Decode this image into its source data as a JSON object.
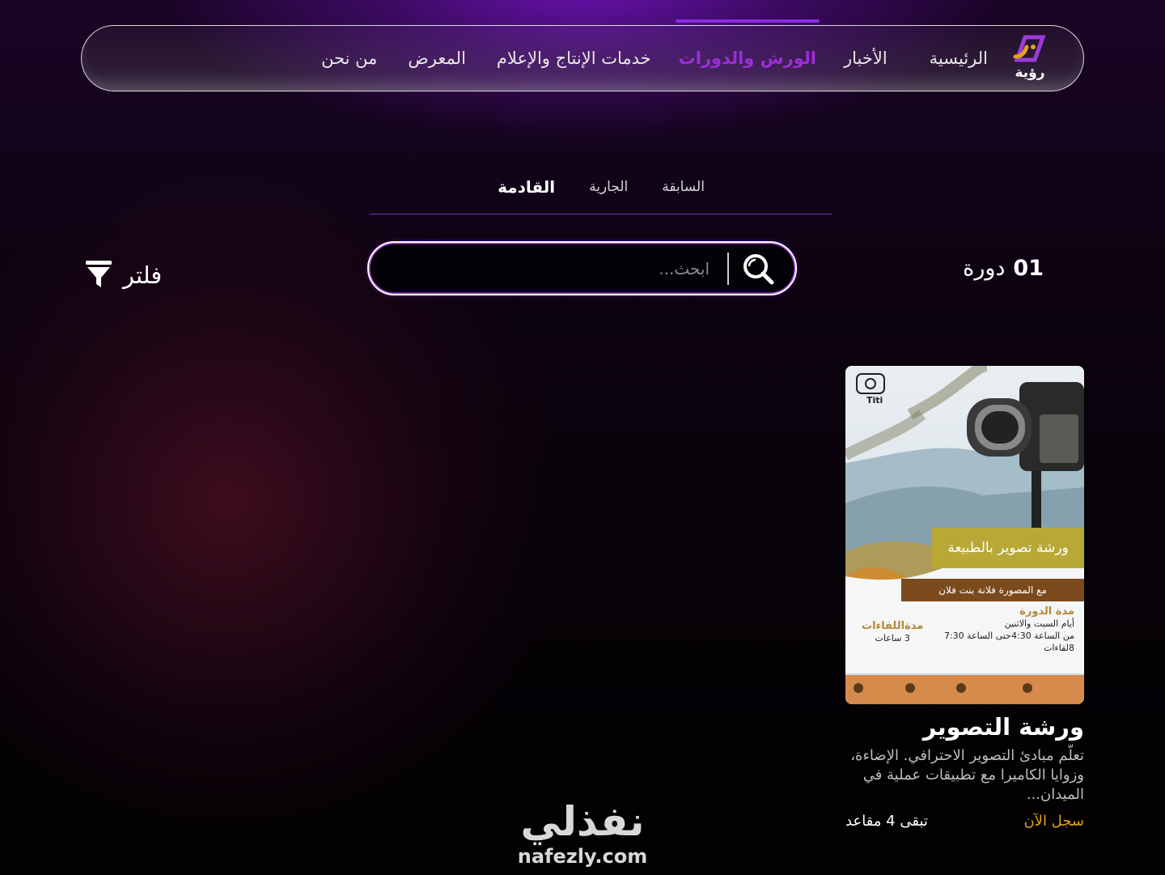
{
  "nav": {
    "logo_text": "رؤية",
    "items": [
      {
        "label": "الرئيسية",
        "active": false
      },
      {
        "label": "الأخبار",
        "active": false
      },
      {
        "label": "الورش والدورات",
        "active": true
      },
      {
        "label": "خدمات الإنتاج والإعلام",
        "active": false
      },
      {
        "label": "المعرض",
        "active": false
      },
      {
        "label": "من نحن",
        "active": false
      }
    ]
  },
  "tabs": [
    {
      "label": "السابقة"
    },
    {
      "label": "الجارية"
    },
    {
      "label": "القادمة"
    }
  ],
  "results": {
    "count": "01",
    "unit": "دورة"
  },
  "search": {
    "placeholder": "ابحث..."
  },
  "filter": {
    "label": "فلتر"
  },
  "card": {
    "title": "ورشة التصوير",
    "description": "تعلّم مبادئ التصوير الاحترافي. الإضاءة، وزوايا الكاميرا مع تطبيقات عملية في الميدان...",
    "register": "سجل الآن",
    "seats": "تبقى 4 مقاعد",
    "poster": {
      "brand": "Titi",
      "title": "ورشة تصوير بالطبيعة",
      "subtitle": "مع المصورة فلانة بنت فلان",
      "duration_head": "مدة الدورة",
      "duration_lines": [
        "أيام السبت والاثنين",
        "من الساعة 4:30حتى الساعة 7:30",
        "8لقاءات"
      ],
      "meetings_head": "مدةاللقاءات",
      "meetings_value": "3 ساعات"
    }
  },
  "watermark": {
    "arabic": "نفذلي",
    "latin": "nafezly.com"
  },
  "colors": {
    "accent": "#8a2be2",
    "register": "#e3a21c"
  }
}
